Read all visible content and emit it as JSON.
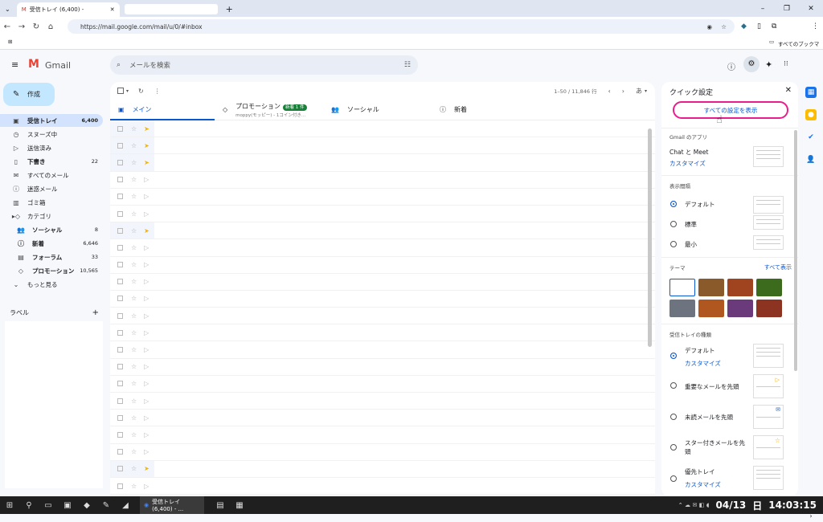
{
  "browser": {
    "tab_title": "受信トレイ (6,400) -",
    "url": "https://mail.google.com/mail/u/0/#inbox",
    "bookmarks_all": "すべてのブックマーク"
  },
  "header": {
    "brand": "Gmail",
    "search_placeholder": "メールを検索"
  },
  "sidebar": {
    "compose": "作成",
    "items": [
      {
        "label": "受信トレイ",
        "count": "6,400",
        "icon": "inbox-icon"
      },
      {
        "label": "スヌーズ中",
        "count": "",
        "icon": "clock-icon"
      },
      {
        "label": "送信済み",
        "count": "",
        "icon": "send-icon"
      },
      {
        "label": "下書き",
        "count": "22",
        "icon": "draft-icon"
      },
      {
        "label": "すべてのメール",
        "count": "",
        "icon": "all-mail-icon"
      },
      {
        "label": "迷惑メール",
        "count": "",
        "icon": "spam-icon"
      },
      {
        "label": "ゴミ箱",
        "count": "",
        "icon": "trash-icon"
      },
      {
        "label": "カテゴリ",
        "count": "",
        "icon": "label-icon"
      },
      {
        "label": "ソーシャル",
        "count": "8",
        "icon": "people-icon"
      },
      {
        "label": "新着",
        "count": "6,646",
        "icon": "info-icon"
      },
      {
        "label": "フォーラム",
        "count": "33",
        "icon": "forum-icon"
      },
      {
        "label": "プロモーション",
        "count": "10,565",
        "icon": "tag-icon"
      },
      {
        "label": "もっと見る",
        "count": "",
        "icon": "chevron-down-icon"
      }
    ],
    "labels_title": "ラベル"
  },
  "toolbar": {
    "range": "1–50 / 11,846 行",
    "lang": "あ"
  },
  "tabs": {
    "main": "メイン",
    "promo": "プロモーション",
    "promo_badge": "新着 1 件",
    "promo_snippet": "moppy(モッピー) - 1コイン付き…",
    "social": "ソーシャル",
    "updates": "新着"
  },
  "rows": [
    1,
    1,
    1,
    0,
    0,
    0,
    1,
    0,
    0,
    0,
    0,
    0,
    0,
    0,
    0,
    0,
    0,
    0,
    0,
    0,
    1,
    0
  ],
  "quick": {
    "title": "クイック設定",
    "all_settings": "すべての設定を表示",
    "apps_head": "Gmail のアプリ",
    "chat_meet": "Chat と Meet",
    "customize": "カスタマイズ",
    "density_head": "表示間隔",
    "density": [
      "デフォルト",
      "標準",
      "最小"
    ],
    "theme_head": "テーマ",
    "theme_all": "すべて表示",
    "inbox_head": "受信トレイの種類",
    "inbox_default": "デフォルト",
    "inbox_important": "重要なメールを先頭",
    "inbox_unread": "未読メールを先頭",
    "inbox_starred": "スター付きメールを先頭",
    "inbox_priority": "優先トレイ"
  },
  "taskbar": {
    "app_label": "受信トレイ (6,400) - ...",
    "date": "04/13",
    "day": "日",
    "time": "14:03:15"
  },
  "colors": {
    "accent": "#0b57d0",
    "highlight": "#e91e8c",
    "active": "#d3e3fd"
  }
}
